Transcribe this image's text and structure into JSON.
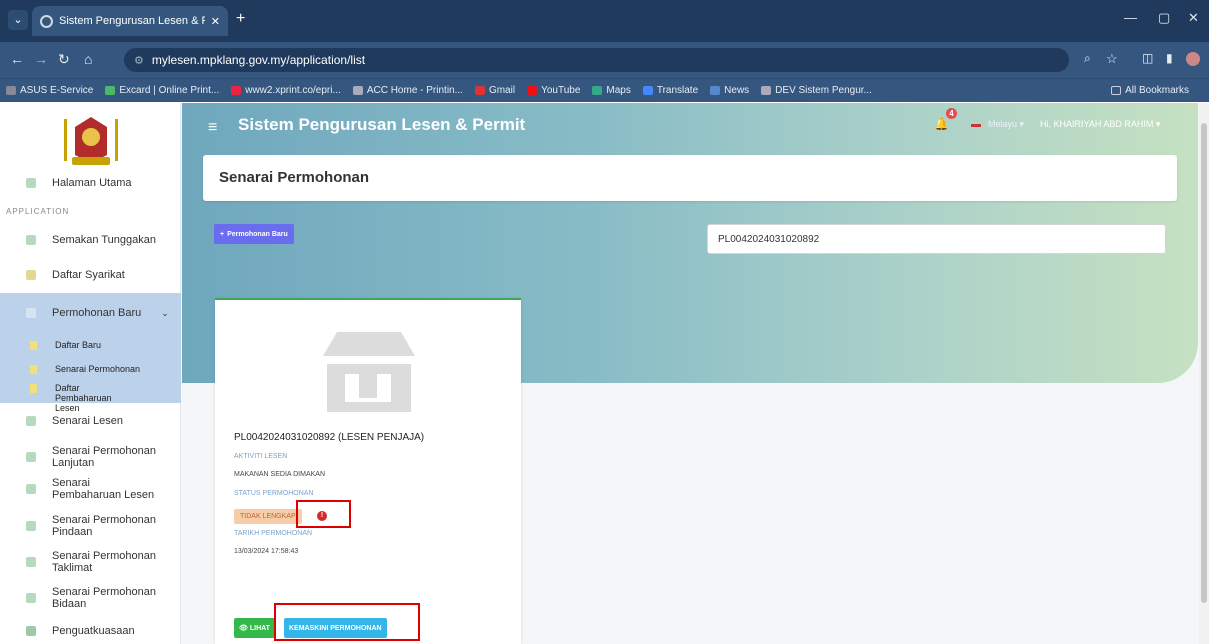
{
  "browser": {
    "tab_title": "Sistem Pengurusan Lesen & Per",
    "url": "mylesen.mpklang.gov.my/application/list",
    "bookmarks": [
      "ASUS E-Service",
      "Excard | Online Print...",
      "www2.xprint.co/epri...",
      "ACC Home - Printin...",
      "Gmail",
      "YouTube",
      "Maps",
      "Translate",
      "News",
      "DEV Sistem Pengur..."
    ],
    "all_bookmarks": "All Bookmarks"
  },
  "header": {
    "title": "Sistem Pengurusan Lesen & Permit",
    "notif_count": "4",
    "language": "Melayu",
    "user": "Hi, KHAIRIYAH ABD RAHIM"
  },
  "sidebar": {
    "home": "Halaman Utama",
    "section": "APPLICATION",
    "items": [
      "Semakan Tunggakan",
      "Daftar Syarikat",
      "Permohonan Baru"
    ],
    "sub": [
      "Daftar Baru",
      "Senarai Permohonan",
      "Daftar Pembaharuan Lesen"
    ],
    "items2": [
      "Senarai Lesen",
      "Senarai Permohonan Lanjutan",
      "Senarai Pembaharuan Lesen",
      "Senarai Permohonan Pindaan",
      "Senarai Permohonan Taklimat",
      "Senarai Permohonan Bidaan",
      "Penguatkuasaan"
    ]
  },
  "main": {
    "page_title": "Senarai Permohonan",
    "new_button": "Permohonan Baru",
    "search_value": "PL0042024031020892"
  },
  "card": {
    "title": "PL0042024031020892 (LESEN PENJAJA)",
    "activity_label": "AKTIVITI LESEN",
    "activity_value": "MAKANAN SEDIA DIMAKAN",
    "status_label": "STATUS PERMOHONAN",
    "status_value": "TIDAK LENGKAP",
    "date_label": "TARIKH PERMOHONAN",
    "date_value": "13/03/2024 17:58:43",
    "view_button": "LIHAT",
    "update_button": "KEMASKINI PERMOHONAN"
  }
}
